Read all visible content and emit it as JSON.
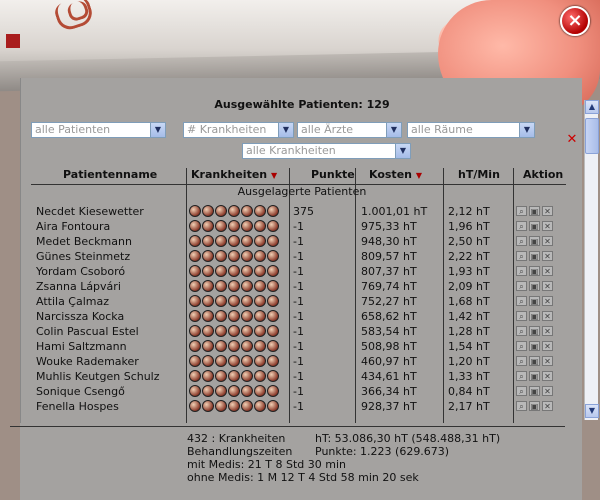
{
  "window": {
    "close_label": "×"
  },
  "header": {
    "title": "Ausgewählte Patienten: 129"
  },
  "filters": {
    "patients": "alle Patienten",
    "diseases_count": "# Krankheiten",
    "doctors": "alle Ärzte",
    "rooms": "alle Räume",
    "diseases": "alle Krankheiten"
  },
  "columns": {
    "name": "Patientenname",
    "diseases": "Krankheiten",
    "points": "Punkte",
    "cost": "Kosten",
    "ht_min": "hT/Min",
    "action": "Aktion"
  },
  "section_label": "Ausgelagerte Patienten",
  "rows": [
    {
      "name": "Necdet Kiesewetter",
      "points": "375",
      "cost": "1.001,01 hT",
      "ht": "2,12 hT"
    },
    {
      "name": "Aira Fontoura",
      "points": "-1",
      "cost": "975,33 hT",
      "ht": "1,96 hT"
    },
    {
      "name": "Medet Beckmann",
      "points": "-1",
      "cost": "948,30 hT",
      "ht": "2,50 hT"
    },
    {
      "name": "Günes Steinmetz",
      "points": "-1",
      "cost": "809,57 hT",
      "ht": "2,22 hT"
    },
    {
      "name": "Yordam Csoboró",
      "points": "-1",
      "cost": "807,37 hT",
      "ht": "1,93 hT"
    },
    {
      "name": "Zsanna Lápvári",
      "points": "-1",
      "cost": "769,74 hT",
      "ht": "2,09 hT"
    },
    {
      "name": "Attila Çalmaz",
      "points": "-1",
      "cost": "752,27 hT",
      "ht": "1,68 hT"
    },
    {
      "name": "Narcissza Kocka",
      "points": "-1",
      "cost": "658,62 hT",
      "ht": "1,42 hT"
    },
    {
      "name": "Colin Pascual Estel",
      "points": "-1",
      "cost": "583,54 hT",
      "ht": "1,28 hT"
    },
    {
      "name": "Hami Saltzmann",
      "points": "-1",
      "cost": "508,98 hT",
      "ht": "1,54 hT"
    },
    {
      "name": "Wouke Rademaker",
      "points": "-1",
      "cost": "460,97 hT",
      "ht": "1,20 hT"
    },
    {
      "name": "Muhlis Keutgen Schulz",
      "points": "-1",
      "cost": "434,61 hT",
      "ht": "1,33 hT"
    },
    {
      "name": "Sonique Csengő",
      "points": "-1",
      "cost": "366,34 hT",
      "ht": "0,84 hT"
    },
    {
      "name": "Fenella Hospes",
      "points": "-1",
      "cost": "928,37 hT",
      "ht": "2,17 hT"
    }
  ],
  "footer": {
    "diseases": "432 : Krankheiten",
    "ht_total": "hT: 53.086,30 hT (548.488,31 hT)",
    "treatment": "Behandlungszeiten",
    "points_total": "Punkte: 1.223 (629.673)",
    "with_meds": "mit Medis: 21 T 8 Std 30 min",
    "without_meds": "ohne Medis: 1 M 12 T 4 Std 58 min 20 sek"
  }
}
